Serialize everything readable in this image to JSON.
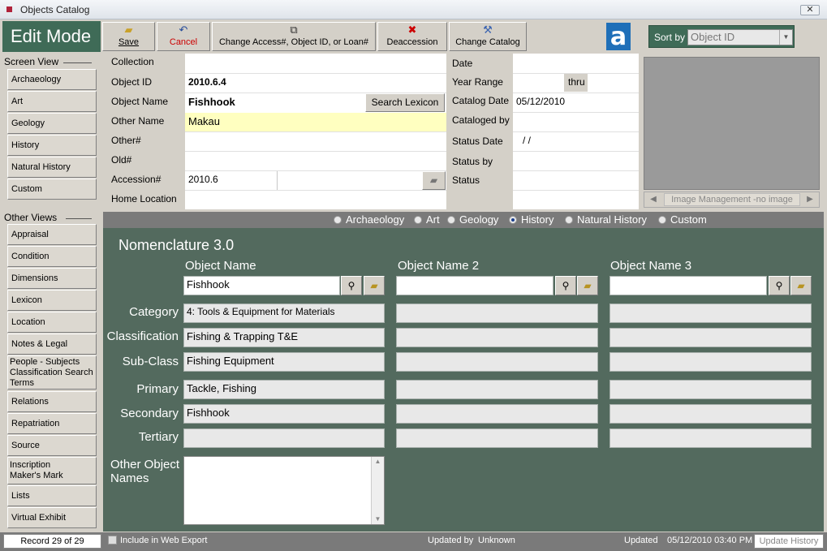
{
  "window": {
    "title": "Objects Catalog",
    "close_symbol": "✕"
  },
  "header": {
    "mode": "Edit Mode",
    "buttons": [
      {
        "label": "Save",
        "icon": "folder-icon"
      },
      {
        "label": "Cancel",
        "icon": "x-icon"
      },
      {
        "label": "Change Access#, Object ID, or Loan#",
        "icon": "swap-icon"
      },
      {
        "label": "Deaccession",
        "icon": "x-icon"
      },
      {
        "label": "Change Catalog",
        "icon": "tools-icon"
      }
    ],
    "logo_letter": "a",
    "sort": {
      "label": "Sort by",
      "value": "Object ID"
    }
  },
  "sidebar": {
    "screen_view_title": "Screen View",
    "screen_view": [
      "Archaeology",
      "Art",
      "Geology",
      "History",
      "Natural History",
      "Custom"
    ],
    "other_views_title": "Other Views",
    "other_views": [
      "Appraisal",
      "Condition",
      "Dimensions",
      "Lexicon",
      "Location",
      "Notes & Legal",
      "People - Subjects Classification Search Terms",
      "Relations",
      "Repatriation",
      "Source",
      "Inscription Maker's Mark",
      "Lists",
      "Virtual Exhibit"
    ]
  },
  "form": {
    "left_labels": [
      "Collection",
      "Object ID",
      "Object Name",
      "Other Name",
      "Other#",
      "Old#",
      "Accession#",
      "Home Location"
    ],
    "collection": "",
    "object_id": "2010.6.4",
    "object_name": "Fishhook",
    "search_lexicon": "Search Lexicon",
    "other_name": "Makau",
    "accession": "2010.6",
    "right_labels": [
      "Date",
      "Year Range",
      "Catalog Date",
      "Cataloged by",
      "Status Date",
      "Status by",
      "Status"
    ],
    "year_range_thru": "thru",
    "catalog_date": "05/12/2010",
    "status_date": "/  /",
    "image_mgmt": "Image Management -no image"
  },
  "views": {
    "options": [
      "Archaeology",
      "Art",
      "Geology",
      "History",
      "Natural History",
      "Custom"
    ],
    "selected": "History"
  },
  "nomenclature": {
    "title": "Nomenclature 3.0",
    "columns": [
      "Object Name",
      "Object Name 2",
      "Object Name 3"
    ],
    "object_names": [
      "Fishhook",
      "",
      ""
    ],
    "row_labels": [
      "Category",
      "Classification",
      "Sub-Class",
      "Primary",
      "Secondary",
      "Tertiary"
    ],
    "col1_values": [
      "4: Tools & Equipment for Materials",
      "Fishing & Trapping T&E",
      "Fishing Equipment",
      "Tackle, Fishing",
      "Fishhook",
      ""
    ],
    "other_names_label": "Other Object Names"
  },
  "status": {
    "record": "Record 29 of 29",
    "web_export": "Include in Web Export",
    "updated_by_label": "Updated by",
    "updated_by": "Unknown",
    "updated_label": "Updated",
    "updated_value": "05/12/2010 03:40 PM",
    "update_history": "Update History"
  }
}
